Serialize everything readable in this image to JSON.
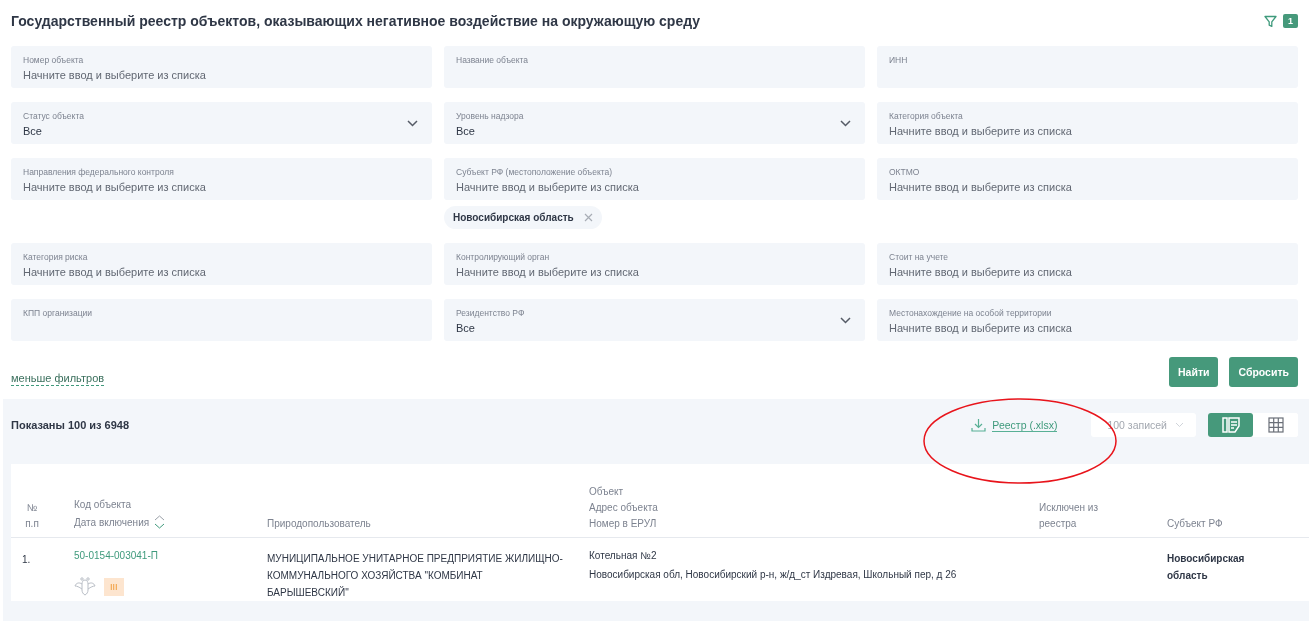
{
  "title": "Государственный реестр объектов, оказывающих негативное воздействие на окружающую среду",
  "filter_badge": "1",
  "filters": [
    {
      "kind": "input",
      "label": "Номер объекта",
      "placeholder": "Начните ввод и выберите из списка"
    },
    {
      "kind": "input",
      "label": "Название объекта"
    },
    {
      "kind": "input",
      "label": "ИНН"
    },
    {
      "kind": "select",
      "label": "Статус объекта",
      "value": "Все"
    },
    {
      "kind": "select",
      "label": "Уровень надзора",
      "value": "Все"
    },
    {
      "kind": "input",
      "label": "Категория объекта",
      "placeholder": "Начните ввод и выберите из списка"
    },
    {
      "kind": "input",
      "label": "Направления федерального контроля",
      "placeholder": "Начните ввод и выберите из списка"
    },
    {
      "kind": "input",
      "label": "Субъект РФ (местоположение объекта)",
      "placeholder": "Начните ввод и выберите из списка",
      "chips": [
        "Новосибирская область"
      ]
    },
    {
      "kind": "input",
      "label": "ОКТМО",
      "placeholder": "Начните ввод и выберите из списка"
    },
    {
      "kind": "input",
      "label": "Категория риска",
      "placeholder": "Начните ввод и выберите из списка"
    },
    {
      "kind": "input",
      "label": "Контролирующий орган",
      "placeholder": "Начните ввод и выберите из списка"
    },
    {
      "kind": "input",
      "label": "Стоит на учете",
      "placeholder": "Начните ввод и выберите из списка"
    },
    {
      "kind": "input",
      "label": "КПП организации"
    },
    {
      "kind": "select",
      "label": "Резидентство РФ",
      "value": "Все"
    },
    {
      "kind": "input",
      "label": "Местонахождение на особой территории",
      "placeholder": "Начните ввод и выберите из списка"
    }
  ],
  "less_filters_link": "меньше фильтров",
  "buttons": [
    "Найти",
    "Сбросить"
  ],
  "results": {
    "count_text": "Показаны 100 из 6948",
    "export_link": "Реестр (.xlsx)",
    "page_size": "100 записей",
    "views": [
      {
        "kind": "list",
        "selected": true
      },
      {
        "kind": "grid",
        "selected": false
      }
    ]
  },
  "table": {
    "columns": [
      [
        "№",
        "п.п"
      ],
      [
        "Код объекта",
        "Дата включения"
      ],
      [
        "Природопользователь"
      ],
      [
        "Объект",
        "Адрес объекта",
        "Номер в ЕРУЛ"
      ],
      [
        "Исключен из",
        "реестра"
      ],
      [
        "Субъект РФ"
      ]
    ],
    "rows": [
      {
        "number": "1.",
        "code": "50-0154-003041-П",
        "category": "III",
        "user": "МУНИЦИПАЛЬНОЕ УНИТАРНОЕ ПРЕДПРИЯТИЕ ЖИЛИЩНО-КОММУНАЛЬНОГО ХОЗЯЙСТВА \"КОМБИНАТ БАРЫШЕВСКИЙ\"",
        "object": "Котельная №2",
        "address": "Новосибирская обл, Новосибирский р-н, ж/д_ст Издревая, Школьный пер, д 26",
        "subject": "Новосибирская область"
      }
    ]
  }
}
